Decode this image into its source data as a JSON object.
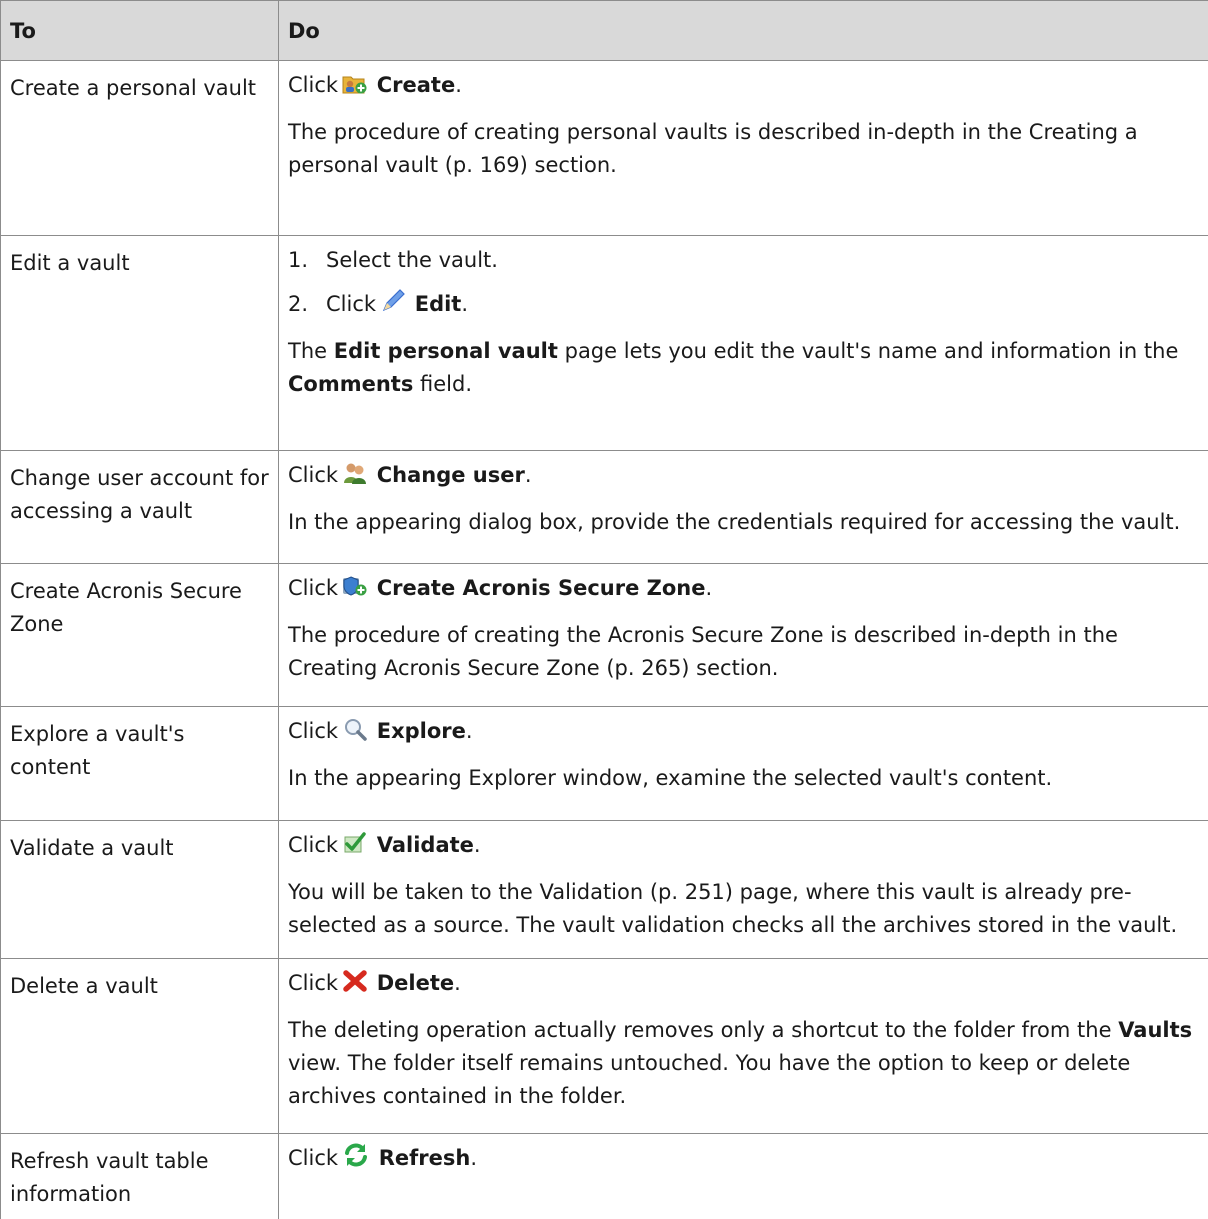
{
  "table": {
    "header_to": "To",
    "header_do": "Do",
    "rows": [
      {
        "to": "Create a personal vault",
        "click": "Click",
        "icon": "create-vault-icon",
        "command": "Create",
        "desc": "The procedure of creating personal vaults is described in-depth in the Creating a personal vault (p. 169) section."
      },
      {
        "to": "Edit a vault",
        "step1_num": "1.",
        "step1": "Select the vault.",
        "step2_num": "2.",
        "click": "Click",
        "icon": "pencil-icon",
        "command": "Edit",
        "desc_prefix": "The",
        "desc_bold1": "Edit personal vault",
        "desc_mid": "page lets you edit the vault's name and information in the",
        "desc_bold2": "Comments",
        "desc_suffix": "field."
      },
      {
        "to": "Change user account for accessing a vault",
        "click": "Click",
        "icon": "change-user-icon",
        "command": "Change user",
        "desc": "In the appearing dialog box, provide the credentials required for accessing the vault."
      },
      {
        "to": "Create Acronis Secure Zone",
        "click": "Click",
        "icon": "secure-zone-icon",
        "command": "Create Acronis Secure Zone",
        "desc": "The procedure of creating the Acronis Secure Zone is described in-depth in the Creating Acronis Secure Zone (p. 265) section."
      },
      {
        "to": "Explore a vault's content",
        "click": "Click",
        "icon": "magnifier-icon",
        "command": "Explore",
        "desc": "In the appearing Explorer window, examine the selected vault's content."
      },
      {
        "to": "Validate a vault",
        "click": "Click",
        "icon": "validate-icon",
        "command": "Validate",
        "desc": "You will be taken to the Validation (p. 251) page, where this vault is already pre-selected as a source. The vault validation checks all the archives stored in the vault."
      },
      {
        "to": "Delete a vault",
        "click": "Click",
        "icon": "delete-icon",
        "command": "Delete",
        "desc_prefix": "The deleting operation actually removes only a shortcut to the folder from the",
        "desc_bold": "Vaults",
        "desc_suffix": "view. The folder itself remains untouched. You have the option to keep or delete archives contained in the folder."
      },
      {
        "to": "Refresh vault table information",
        "click": "Click",
        "icon": "refresh-icon",
        "command": "Refresh"
      }
    ]
  },
  "colors": {
    "header_bg": "#d9d9d9",
    "border": "#8c8c8c",
    "delete_red": "#d62a1e",
    "refresh_green": "#2aa84a",
    "pencil_blue": "#3b6fcf"
  }
}
